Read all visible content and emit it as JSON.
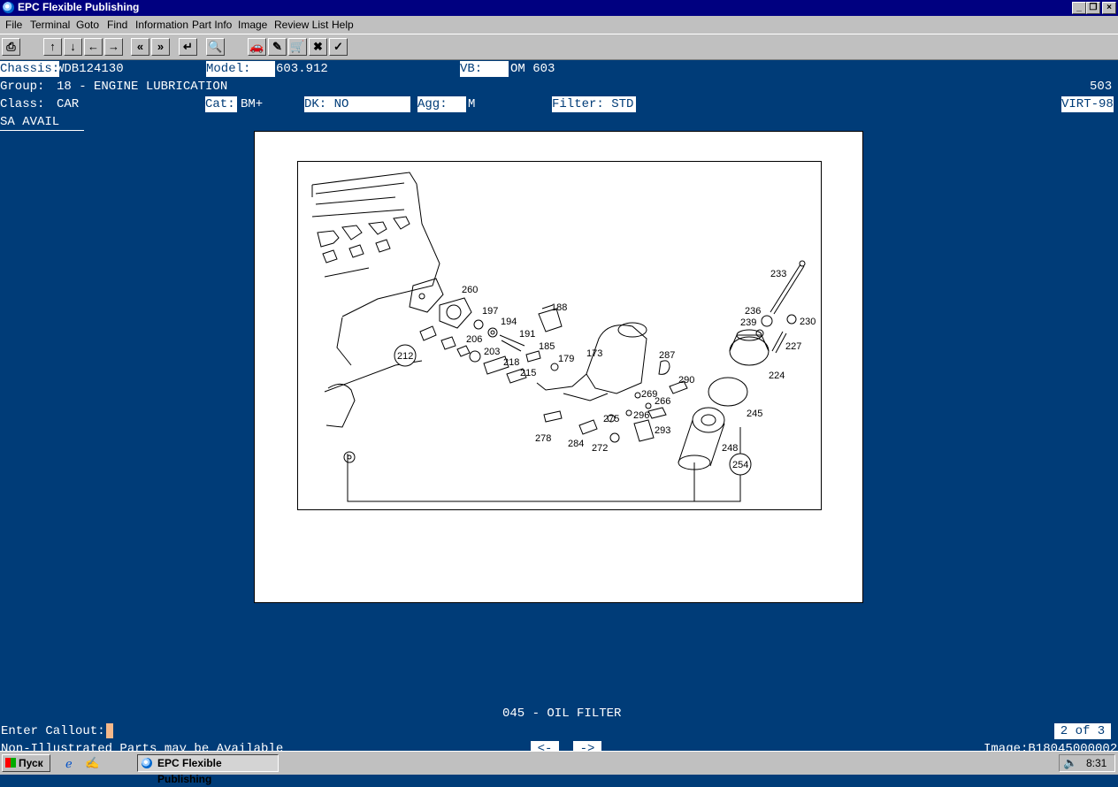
{
  "window": {
    "title": "EPC Flexible Publishing"
  },
  "menu": [
    "File",
    "Terminal",
    "Goto",
    "Find",
    "Information",
    "Part Info",
    "Image",
    "Review List",
    "Help"
  ],
  "header": {
    "chassis_label": "Chassis:",
    "chassis_value": "WDB124130",
    "model_label": "Model:",
    "model_value": "603.912",
    "vb_label": "VB:",
    "vb_value": "OM 603",
    "group_label": "Group:",
    "group_value": "18 - ENGINE LUBRICATION",
    "group_code": "503",
    "class_label": "Class:",
    "class_value": "CAR",
    "cat_label": "Cat:",
    "cat_value": "BM+",
    "dk_value": "DK: NO",
    "agg_label": "Agg:",
    "agg_value": "M",
    "filter_value": "Filter: STD",
    "virt_value": "VIRT-98",
    "sa_value": "SA AVAIL"
  },
  "drawing": {
    "callouts": [
      "260",
      "197",
      "194",
      "188",
      "191",
      "185",
      "179",
      "173",
      "206",
      "203",
      "218",
      "215",
      "212",
      "287",
      "290",
      "269",
      "266",
      "275",
      "296",
      "293",
      "278",
      "284",
      "272",
      "233",
      "236",
      "239",
      "230",
      "227",
      "224",
      "245",
      "248",
      "254"
    ]
  },
  "footer": {
    "section_title": "045 - OIL FILTER",
    "callout_label": "Enter Callout:",
    "page_indicator": "2 of 3",
    "note": "Non-Illustrated Parts may be Available",
    "prev_label": "<-",
    "next_label": "->",
    "image_id": "Image:B18045000002"
  },
  "taskbar": {
    "start_label": "Пуск",
    "task_label": "EPC Flexible Publishing",
    "clock": "8:31"
  }
}
